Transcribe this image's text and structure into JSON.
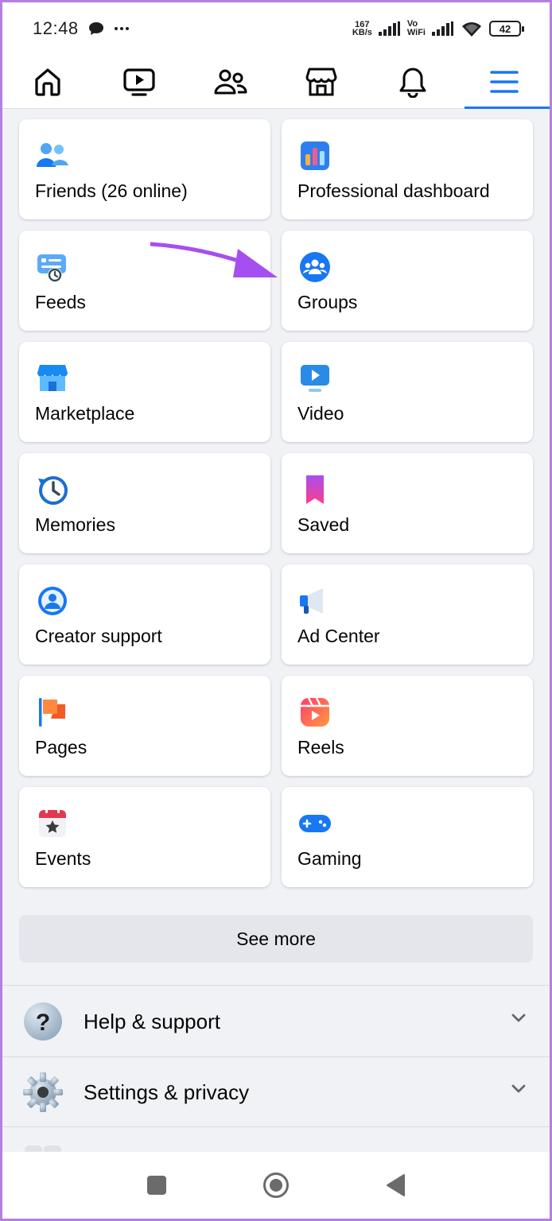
{
  "status_bar": {
    "time": "12:48",
    "speed_value": "167",
    "speed_unit": "KB/s",
    "vo": "Vo",
    "wifi_text": "WiFi",
    "battery": "42"
  },
  "nav": {
    "items": [
      "home-icon",
      "video-icon",
      "friends-icon",
      "marketplace-icon",
      "notifications-icon",
      "menu-icon"
    ],
    "active_color": "#1877f2"
  },
  "shortcuts": [
    {
      "label": "Friends (26 online)",
      "icon": "friends-icon"
    },
    {
      "label": "Professional dashboard",
      "icon": "dashboard-icon"
    },
    {
      "label": "Feeds",
      "icon": "feeds-icon"
    },
    {
      "label": "Groups",
      "icon": "groups-icon"
    },
    {
      "label": "Marketplace",
      "icon": "marketplace-icon"
    },
    {
      "label": "Video",
      "icon": "video-icon"
    },
    {
      "label": "Memories",
      "icon": "memories-icon"
    },
    {
      "label": "Saved",
      "icon": "saved-icon"
    },
    {
      "label": "Creator support",
      "icon": "creator-support-icon"
    },
    {
      "label": "Ad Center",
      "icon": "ad-center-icon"
    },
    {
      "label": "Pages",
      "icon": "pages-icon"
    },
    {
      "label": "Reels",
      "icon": "reels-icon"
    },
    {
      "label": "Events",
      "icon": "events-icon"
    },
    {
      "label": "Gaming",
      "icon": "gaming-icon"
    }
  ],
  "see_more": "See more",
  "sections": {
    "help": "Help & support",
    "settings": "Settings & privacy"
  },
  "colors": {
    "brand_blue": "#1877f2",
    "annotation_arrow": "#a64ff0",
    "background": "#f0f2f5"
  }
}
